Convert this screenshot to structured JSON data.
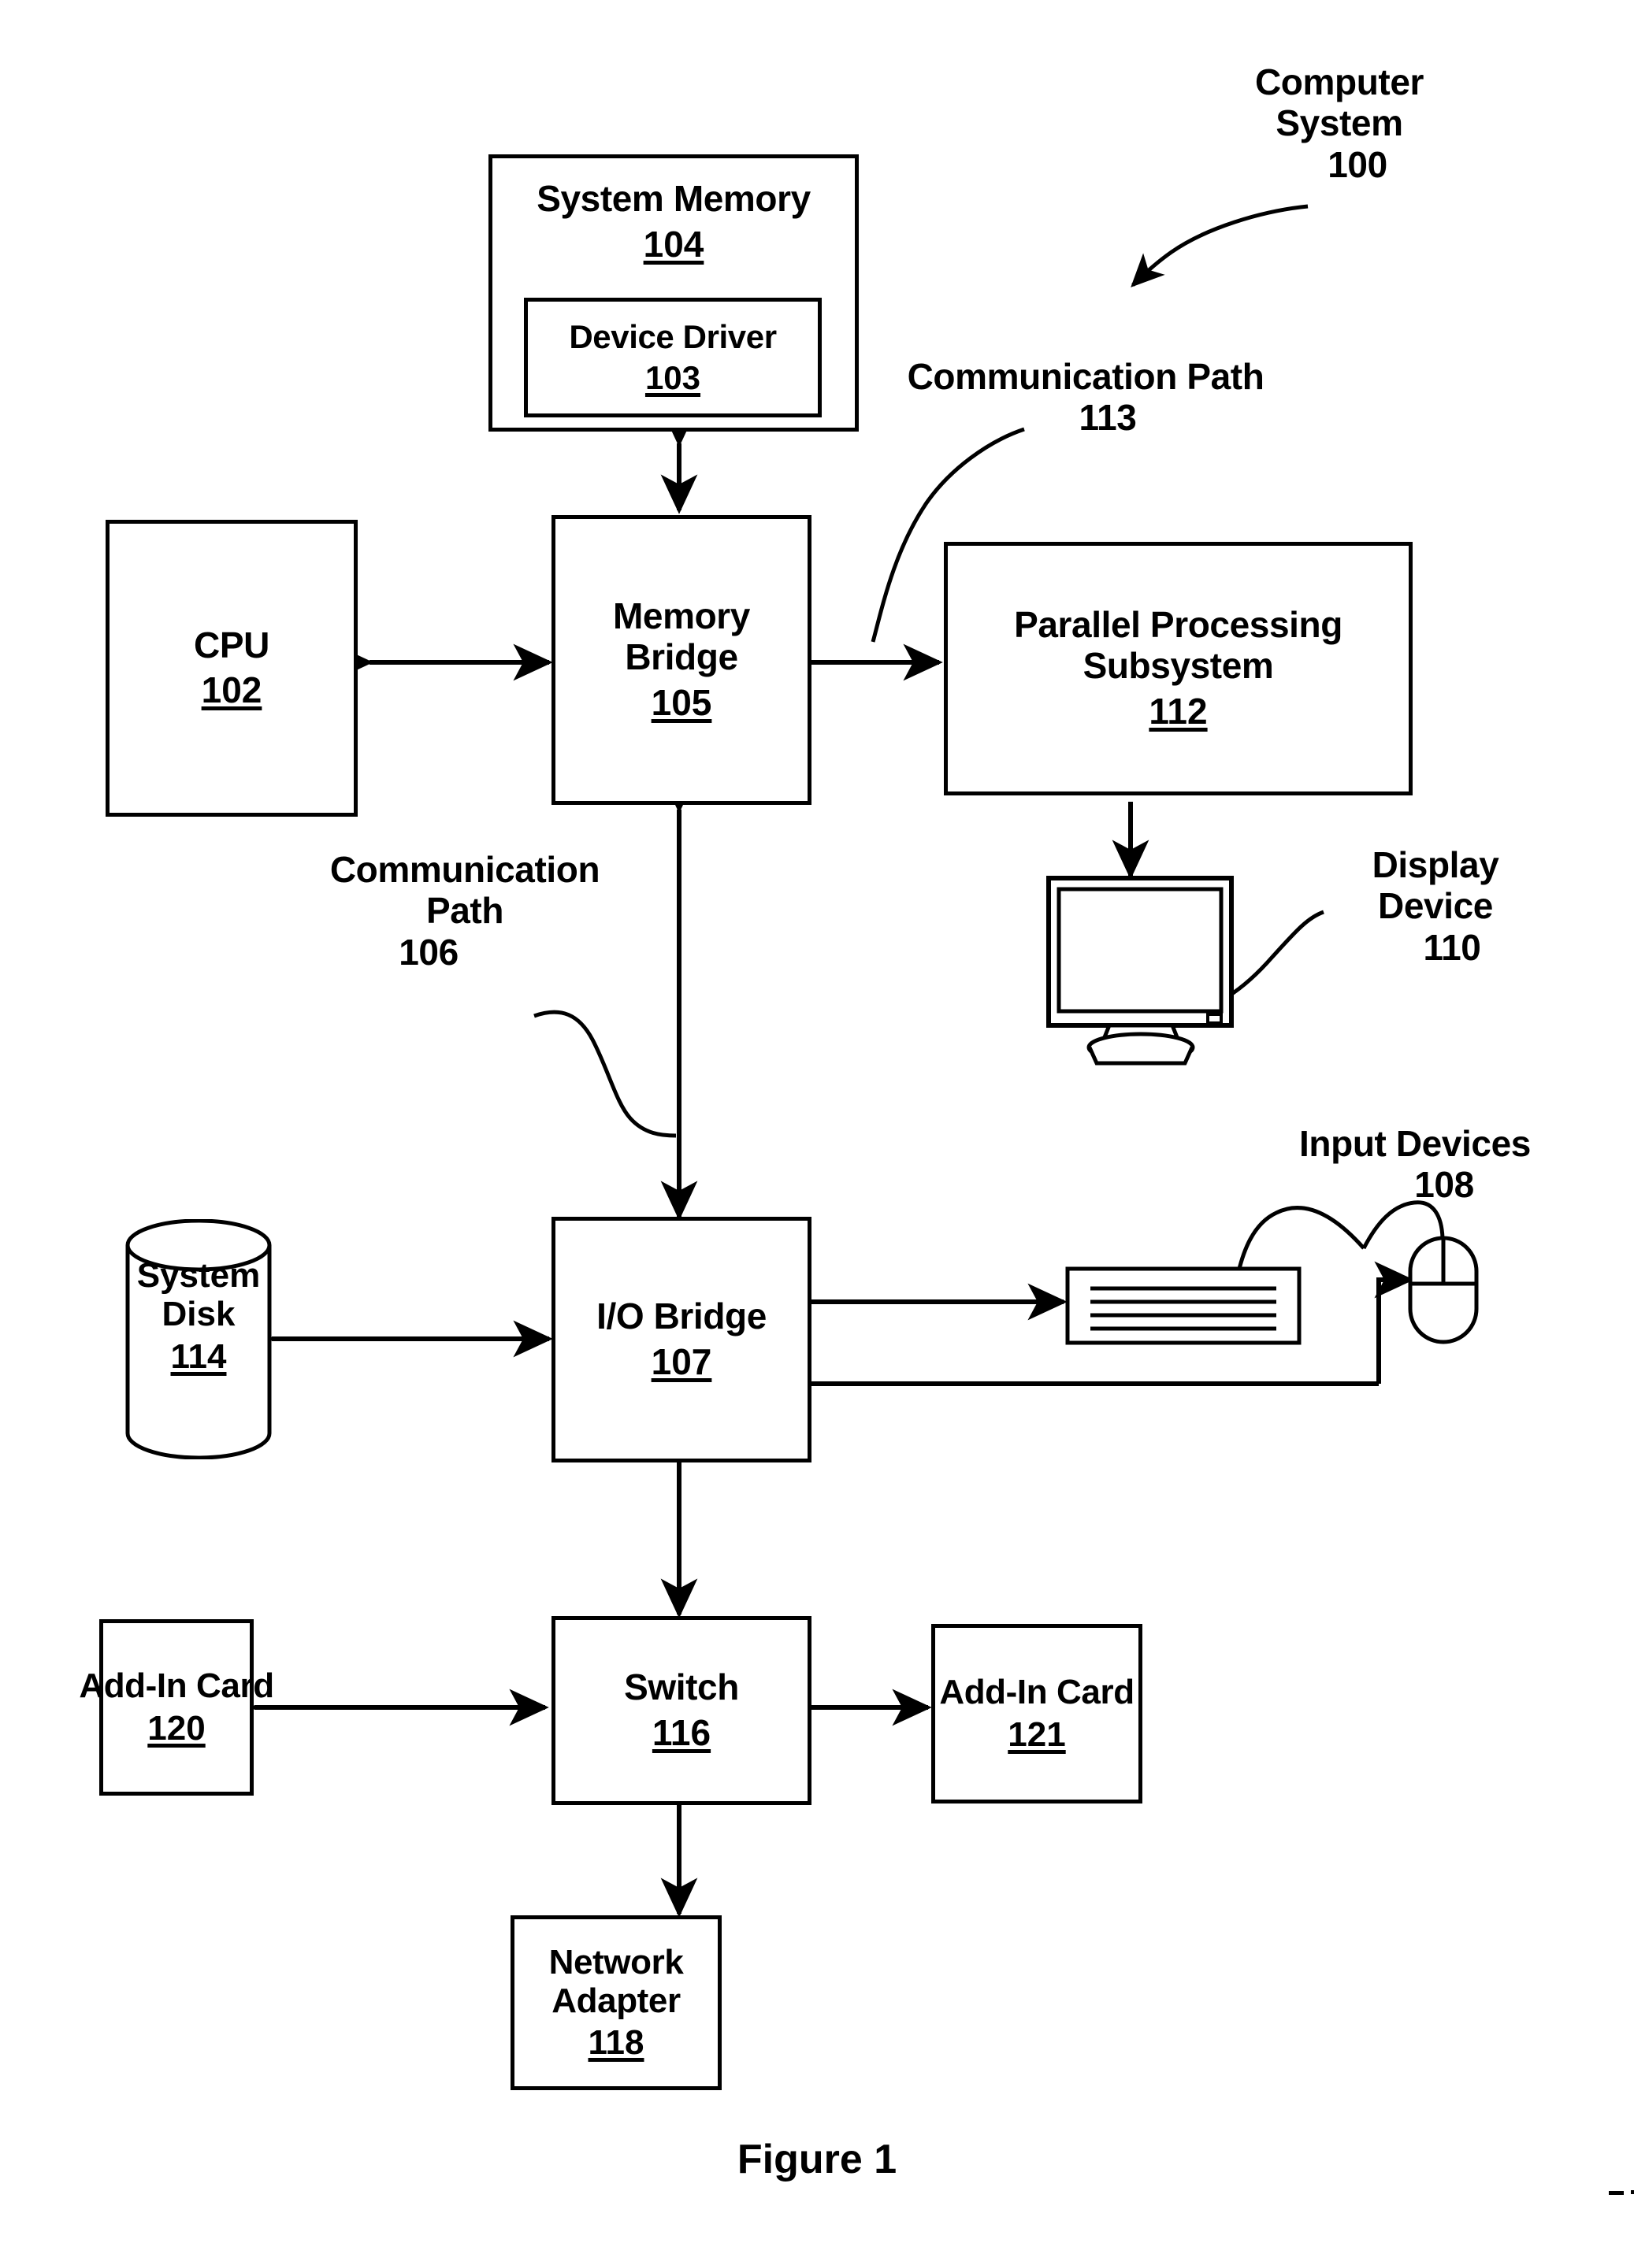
{
  "figure": {
    "caption": "Figure 1"
  },
  "callouts": [
    {
      "id": "computer-system",
      "lines": [
        "Computer",
        "System"
      ],
      "number": "100"
    },
    {
      "id": "communication-path-113",
      "lines": [
        "Communication Path"
      ],
      "number": "113"
    },
    {
      "id": "communication-path-106",
      "lines": [
        "Communication",
        "Path"
      ],
      "number": "106"
    },
    {
      "id": "display-device",
      "lines": [
        "Display",
        "Device"
      ],
      "number": "110"
    },
    {
      "id": "input-devices",
      "lines": [
        "Input Devices"
      ],
      "number": "108"
    }
  ],
  "blocks": {
    "system_memory": {
      "title": "System Memory",
      "number": "104"
    },
    "device_driver": {
      "title": "Device Driver",
      "number": "103"
    },
    "cpu": {
      "title": "CPU",
      "number": "102"
    },
    "memory_bridge": {
      "title_line1": "Memory",
      "title_line2": "Bridge",
      "number": "105"
    },
    "parallel_processing_subsystem": {
      "title_line1": "Parallel Processing",
      "title_line2": "Subsystem",
      "number": "112"
    },
    "system_disk": {
      "title_line1": "System",
      "title_line2": "Disk",
      "number": "114"
    },
    "io_bridge": {
      "title": "I/O Bridge",
      "number": "107"
    },
    "add_in_card_120": {
      "title": "Add-In Card",
      "number": "120"
    },
    "switch": {
      "title": "Switch",
      "number": "116"
    },
    "add_in_card_121": {
      "title": "Add-In Card",
      "number": "121"
    },
    "network_adapter": {
      "title_line1": "Network",
      "title_line2": "Adapter",
      "number": "118"
    }
  },
  "icons": {
    "display_device": "monitor-icon",
    "keyboard": "keyboard-icon",
    "mouse": "mouse-icon",
    "system_disk": "cylinder-database-icon"
  },
  "colors": {
    "ink": "#000000",
    "paper": "#ffffff"
  }
}
